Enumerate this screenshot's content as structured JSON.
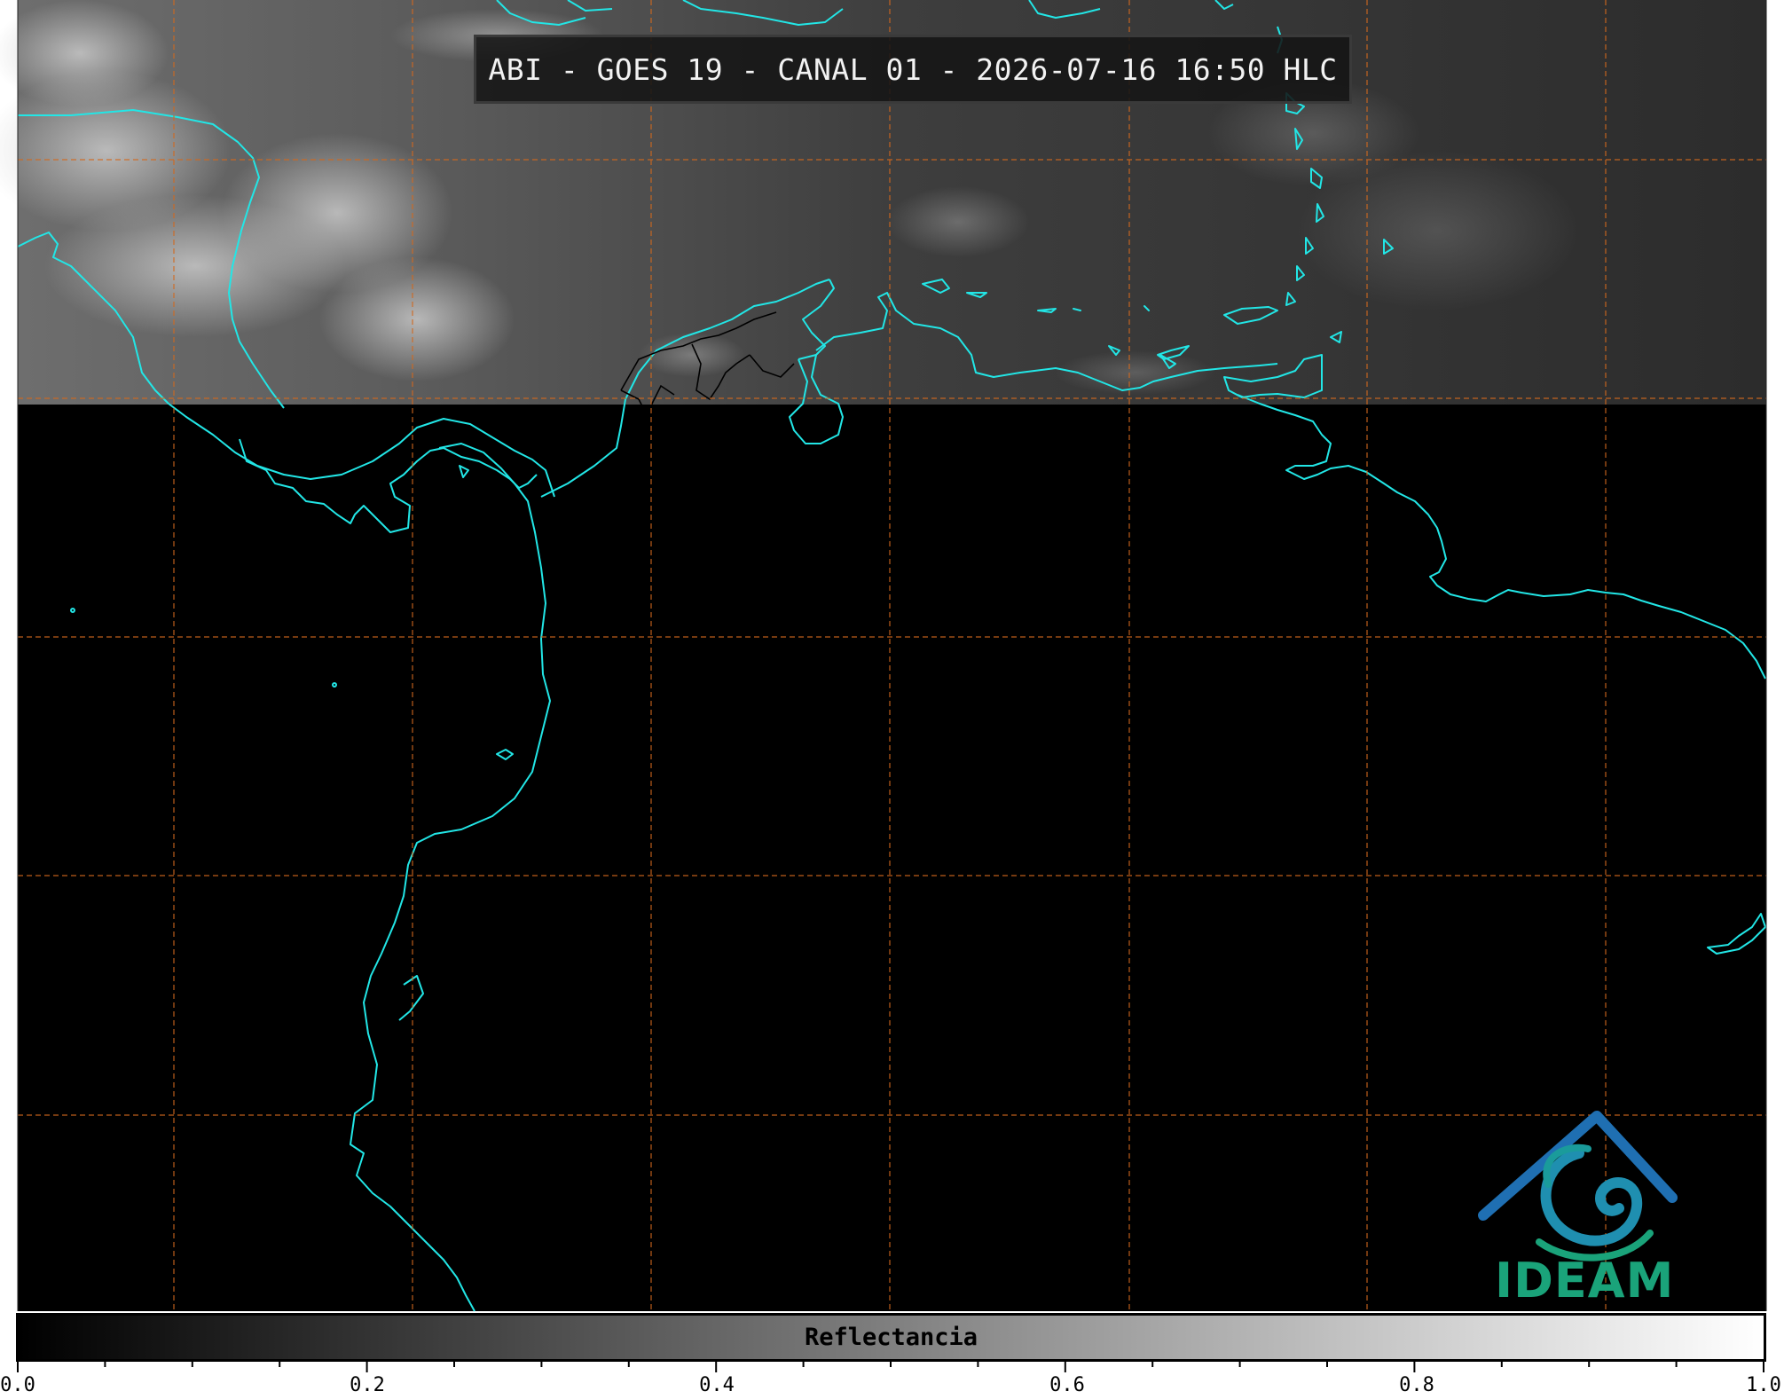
{
  "title": "ABI - GOES 19 - CANAL 01 - 2026-07-16 16:50 HLC",
  "colorbar": {
    "label": "Reflectancia",
    "ticks": [
      "0.0",
      "0.2",
      "0.4",
      "0.6",
      "0.8",
      "1.0"
    ],
    "range": [
      0.0,
      1.0
    ],
    "colormap_start": "#000000",
    "colormap_end": "#ffffff"
  },
  "map": {
    "coastline_color": "#22e6e6",
    "border_color": "#000000",
    "gridline_color": "#d2691e",
    "gridline_style": "dashed",
    "no_data_color": "#000000",
    "lower_region_status": "no data (black)"
  },
  "logo": {
    "text": "IDEAM",
    "colors": [
      "#1f6fb2",
      "#1aa37a"
    ]
  }
}
